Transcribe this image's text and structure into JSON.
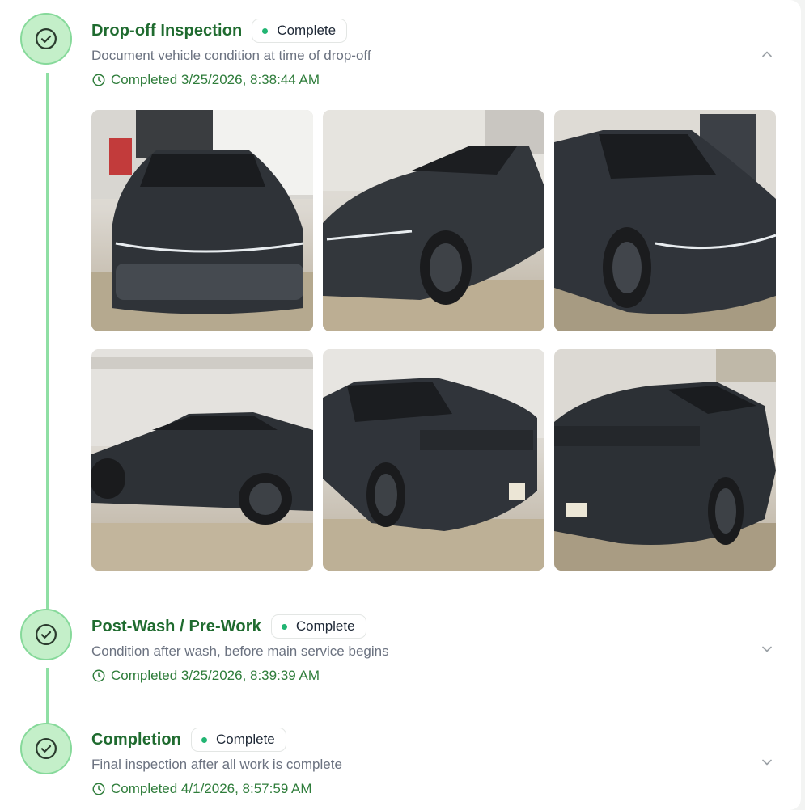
{
  "steps": [
    {
      "title": "Drop-off Inspection",
      "status": "Complete",
      "description": "Document vehicle condition at time of drop-off",
      "completed": "Completed 3/25/2026, 8:38:44 AM",
      "expanded": true,
      "photos": [
        {
          "label": "front view"
        },
        {
          "label": "front three-quarter right"
        },
        {
          "label": "front three-quarter left"
        },
        {
          "label": "side profile"
        },
        {
          "label": "rear three-quarter left"
        },
        {
          "label": "rear three-quarter right"
        }
      ]
    },
    {
      "title": "Post-Wash / Pre-Work",
      "status": "Complete",
      "description": "Condition after wash, before main service begins",
      "completed": "Completed 3/25/2026, 8:39:39 AM",
      "expanded": false
    },
    {
      "title": "Completion",
      "status": "Complete",
      "description": "Final inspection after all work is complete",
      "completed": "Completed 4/1/2026, 8:57:59 AM",
      "expanded": false
    }
  ],
  "icons": {
    "step_done": "check-circle-icon",
    "timestamp": "clock-icon",
    "collapse": "chevron-up-icon",
    "expand": "chevron-down-icon"
  },
  "colors": {
    "accent_green": "#1f6b2f",
    "status_dot": "#22b573",
    "rail": "#8fdfa4",
    "icon_bg": "#c4efc9"
  }
}
